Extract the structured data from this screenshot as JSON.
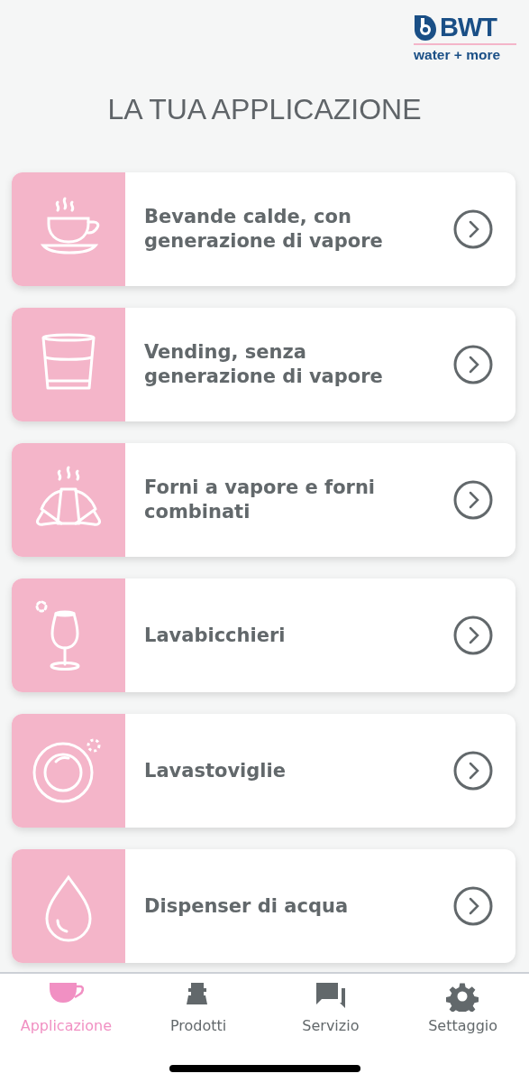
{
  "logo": {
    "brand": "BWT",
    "tagline": "water + more"
  },
  "title": "LA TUA APPLICAZIONE",
  "applications": [
    {
      "label": "Bevande calde, con generazione di vapore"
    },
    {
      "label": "Vending, senza generazione di vapore"
    },
    {
      "label": "Forni a vapore e forni combinati"
    },
    {
      "label": "Lavabicchieri"
    },
    {
      "label": "Lavastoviglie"
    },
    {
      "label": "Dispenser di acqua"
    }
  ],
  "tab_bar": [
    {
      "label": "Applicazione",
      "selected": true
    },
    {
      "label": "Prodotti",
      "selected": false
    },
    {
      "label": "Servizio",
      "selected": false
    },
    {
      "label": "Settaggio",
      "selected": false
    }
  ]
}
